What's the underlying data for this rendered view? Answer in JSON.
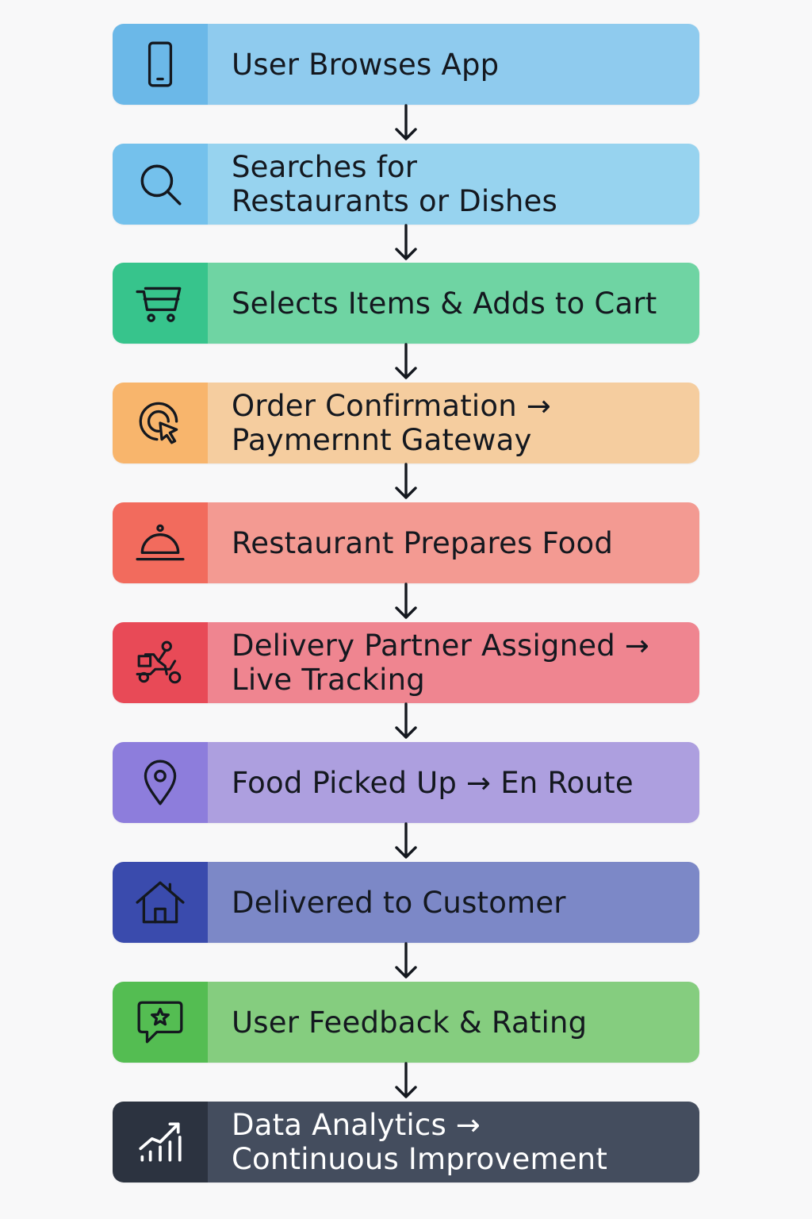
{
  "steps": [
    {
      "label": "User Browses App",
      "icon": "smartphone-icon",
      "icon_color": "#6bb8e8",
      "label_color": "#8fcbee"
    },
    {
      "label": "Searches for\nRestaurants or Dishes",
      "icon": "search-icon",
      "icon_color": "#74c1ec",
      "label_color": "#97d3ef"
    },
    {
      "label": "Selects Items & Adds to Cart",
      "icon": "cart-icon",
      "icon_color": "#37c48c",
      "label_color": "#6fd4a3"
    },
    {
      "label": "Order Confirmation →\nPaymernnt Gateway",
      "icon": "payment-tap-icon",
      "icon_color": "#f8b56c",
      "label_color": "#f5cd9f"
    },
    {
      "label": "Restaurant Prepares Food",
      "icon": "food-cloche-icon",
      "icon_color": "#f26b5d",
      "label_color": "#f39a92"
    },
    {
      "label": "Delivery Partner Assigned →\nLive Tracking",
      "icon": "delivery-scooter-icon",
      "icon_color": "#e84a57",
      "label_color": "#ef8590"
    },
    {
      "label": "Food Picked Up → En Route",
      "icon": "location-pin-icon",
      "icon_color": "#8d7ddc",
      "label_color": "#ad9fdf"
    },
    {
      "label": "Delivered to Customer",
      "icon": "home-icon",
      "icon_color": "#3a4bad",
      "label_color": "#7c88c7"
    },
    {
      "label": "User Feedback & Rating",
      "icon": "feedback-star-icon",
      "icon_color": "#54bd52",
      "label_color": "#85cd7f"
    },
    {
      "label": "Data Analytics →\nContinuous Improvement",
      "icon": "analytics-chart-icon",
      "icon_color": "#2c3340",
      "label_color": "#444d5e"
    }
  ]
}
